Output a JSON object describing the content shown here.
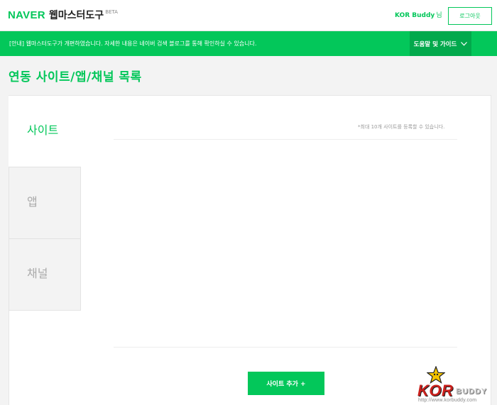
{
  "header": {
    "brand": "NAVER",
    "service": "웹마스터도구",
    "badge": "BETA",
    "user_name": "KOR Buddy",
    "user_suffix": "님",
    "logout_label": "로그아웃"
  },
  "notice": {
    "text": "[안내] 웹마스터도구가 개편하였습니다. 자세한 내용은 네이버 검색 블로그를 통해 확인하실 수 있습니다.",
    "help_label": "도움말 및 가이드"
  },
  "page": {
    "title": "연동 사이트/앱/채널 목록"
  },
  "tabs": [
    {
      "label": "사이트",
      "active": true
    },
    {
      "label": "앱",
      "active": false
    },
    {
      "label": "채널",
      "active": false
    }
  ],
  "content": {
    "limit_note": "*최대 10개 사이트를 등록할 수 있습니다.",
    "add_button_label": "사이트 추가 +"
  },
  "watermark": {
    "text_kor": "KOR",
    "text_buddy": "BUDDY",
    "url": "http://www.korbuddy.com"
  },
  "colors": {
    "brand_green": "#03c75a",
    "help_green": "#02a94c",
    "watermark_red": "#c9201c"
  },
  "icons": {
    "help_chevron": "chevron-down-icon",
    "watermark_star": "star-icon"
  }
}
